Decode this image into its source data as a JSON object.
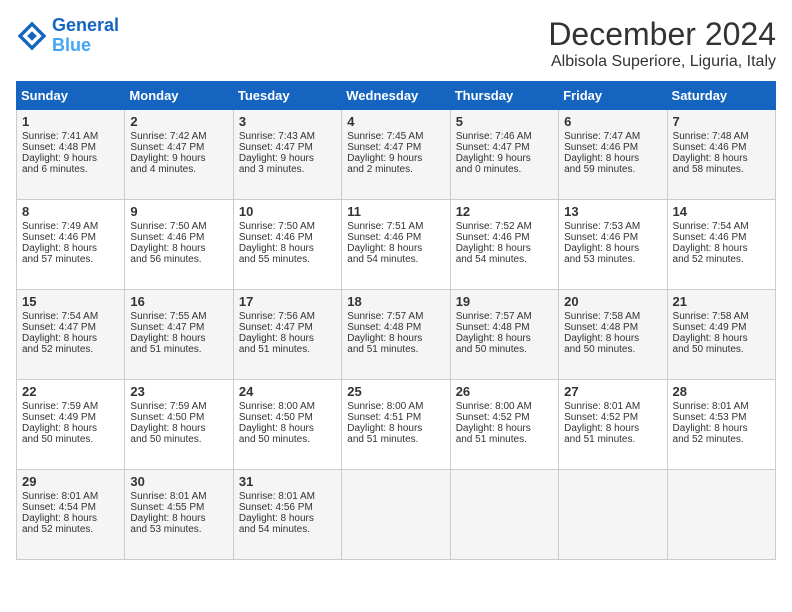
{
  "logo": {
    "line1": "General",
    "line2": "Blue"
  },
  "title": "December 2024",
  "subtitle": "Albisola Superiore, Liguria, Italy",
  "days_of_week": [
    "Sunday",
    "Monday",
    "Tuesday",
    "Wednesday",
    "Thursday",
    "Friday",
    "Saturday"
  ],
  "weeks": [
    [
      {
        "day": "1",
        "lines": [
          "Sunrise: 7:41 AM",
          "Sunset: 4:48 PM",
          "Daylight: 9 hours",
          "and 6 minutes."
        ]
      },
      {
        "day": "2",
        "lines": [
          "Sunrise: 7:42 AM",
          "Sunset: 4:47 PM",
          "Daylight: 9 hours",
          "and 4 minutes."
        ]
      },
      {
        "day": "3",
        "lines": [
          "Sunrise: 7:43 AM",
          "Sunset: 4:47 PM",
          "Daylight: 9 hours",
          "and 3 minutes."
        ]
      },
      {
        "day": "4",
        "lines": [
          "Sunrise: 7:45 AM",
          "Sunset: 4:47 PM",
          "Daylight: 9 hours",
          "and 2 minutes."
        ]
      },
      {
        "day": "5",
        "lines": [
          "Sunrise: 7:46 AM",
          "Sunset: 4:47 PM",
          "Daylight: 9 hours",
          "and 0 minutes."
        ]
      },
      {
        "day": "6",
        "lines": [
          "Sunrise: 7:47 AM",
          "Sunset: 4:46 PM",
          "Daylight: 8 hours",
          "and 59 minutes."
        ]
      },
      {
        "day": "7",
        "lines": [
          "Sunrise: 7:48 AM",
          "Sunset: 4:46 PM",
          "Daylight: 8 hours",
          "and 58 minutes."
        ]
      }
    ],
    [
      {
        "day": "8",
        "lines": [
          "Sunrise: 7:49 AM",
          "Sunset: 4:46 PM",
          "Daylight: 8 hours",
          "and 57 minutes."
        ]
      },
      {
        "day": "9",
        "lines": [
          "Sunrise: 7:50 AM",
          "Sunset: 4:46 PM",
          "Daylight: 8 hours",
          "and 56 minutes."
        ]
      },
      {
        "day": "10",
        "lines": [
          "Sunrise: 7:50 AM",
          "Sunset: 4:46 PM",
          "Daylight: 8 hours",
          "and 55 minutes."
        ]
      },
      {
        "day": "11",
        "lines": [
          "Sunrise: 7:51 AM",
          "Sunset: 4:46 PM",
          "Daylight: 8 hours",
          "and 54 minutes."
        ]
      },
      {
        "day": "12",
        "lines": [
          "Sunrise: 7:52 AM",
          "Sunset: 4:46 PM",
          "Daylight: 8 hours",
          "and 54 minutes."
        ]
      },
      {
        "day": "13",
        "lines": [
          "Sunrise: 7:53 AM",
          "Sunset: 4:46 PM",
          "Daylight: 8 hours",
          "and 53 minutes."
        ]
      },
      {
        "day": "14",
        "lines": [
          "Sunrise: 7:54 AM",
          "Sunset: 4:46 PM",
          "Daylight: 8 hours",
          "and 52 minutes."
        ]
      }
    ],
    [
      {
        "day": "15",
        "lines": [
          "Sunrise: 7:54 AM",
          "Sunset: 4:47 PM",
          "Daylight: 8 hours",
          "and 52 minutes."
        ]
      },
      {
        "day": "16",
        "lines": [
          "Sunrise: 7:55 AM",
          "Sunset: 4:47 PM",
          "Daylight: 8 hours",
          "and 51 minutes."
        ]
      },
      {
        "day": "17",
        "lines": [
          "Sunrise: 7:56 AM",
          "Sunset: 4:47 PM",
          "Daylight: 8 hours",
          "and 51 minutes."
        ]
      },
      {
        "day": "18",
        "lines": [
          "Sunrise: 7:57 AM",
          "Sunset: 4:48 PM",
          "Daylight: 8 hours",
          "and 51 minutes."
        ]
      },
      {
        "day": "19",
        "lines": [
          "Sunrise: 7:57 AM",
          "Sunset: 4:48 PM",
          "Daylight: 8 hours",
          "and 50 minutes."
        ]
      },
      {
        "day": "20",
        "lines": [
          "Sunrise: 7:58 AM",
          "Sunset: 4:48 PM",
          "Daylight: 8 hours",
          "and 50 minutes."
        ]
      },
      {
        "day": "21",
        "lines": [
          "Sunrise: 7:58 AM",
          "Sunset: 4:49 PM",
          "Daylight: 8 hours",
          "and 50 minutes."
        ]
      }
    ],
    [
      {
        "day": "22",
        "lines": [
          "Sunrise: 7:59 AM",
          "Sunset: 4:49 PM",
          "Daylight: 8 hours",
          "and 50 minutes."
        ]
      },
      {
        "day": "23",
        "lines": [
          "Sunrise: 7:59 AM",
          "Sunset: 4:50 PM",
          "Daylight: 8 hours",
          "and 50 minutes."
        ]
      },
      {
        "day": "24",
        "lines": [
          "Sunrise: 8:00 AM",
          "Sunset: 4:50 PM",
          "Daylight: 8 hours",
          "and 50 minutes."
        ]
      },
      {
        "day": "25",
        "lines": [
          "Sunrise: 8:00 AM",
          "Sunset: 4:51 PM",
          "Daylight: 8 hours",
          "and 51 minutes."
        ]
      },
      {
        "day": "26",
        "lines": [
          "Sunrise: 8:00 AM",
          "Sunset: 4:52 PM",
          "Daylight: 8 hours",
          "and 51 minutes."
        ]
      },
      {
        "day": "27",
        "lines": [
          "Sunrise: 8:01 AM",
          "Sunset: 4:52 PM",
          "Daylight: 8 hours",
          "and 51 minutes."
        ]
      },
      {
        "day": "28",
        "lines": [
          "Sunrise: 8:01 AM",
          "Sunset: 4:53 PM",
          "Daylight: 8 hours",
          "and 52 minutes."
        ]
      }
    ],
    [
      {
        "day": "29",
        "lines": [
          "Sunrise: 8:01 AM",
          "Sunset: 4:54 PM",
          "Daylight: 8 hours",
          "and 52 minutes."
        ]
      },
      {
        "day": "30",
        "lines": [
          "Sunrise: 8:01 AM",
          "Sunset: 4:55 PM",
          "Daylight: 8 hours",
          "and 53 minutes."
        ]
      },
      {
        "day": "31",
        "lines": [
          "Sunrise: 8:01 AM",
          "Sunset: 4:56 PM",
          "Daylight: 8 hours",
          "and 54 minutes."
        ]
      },
      null,
      null,
      null,
      null
    ]
  ]
}
